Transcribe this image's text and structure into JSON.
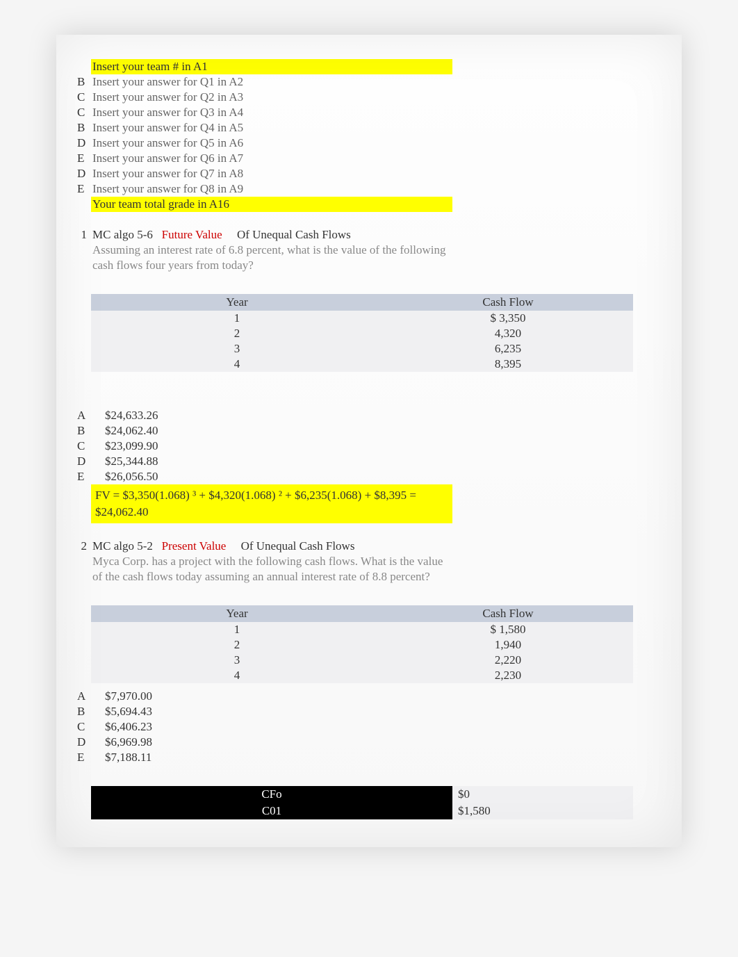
{
  "header": {
    "team_instruction": "Insert your team # in A1",
    "rows": [
      {
        "letter": "B",
        "text": "Insert your answer for Q1 in A2"
      },
      {
        "letter": "C",
        "text": "Insert your answer for Q2 in A3"
      },
      {
        "letter": "C",
        "text": "Insert your answer for Q3 in A4"
      },
      {
        "letter": "B",
        "text": "Insert your answer for Q4 in A5"
      },
      {
        "letter": "D",
        "text": "Insert your answer for Q5 in A6"
      },
      {
        "letter": "E",
        "text": "Insert your answer for Q6 in A7"
      },
      {
        "letter": "D",
        "text": "Insert your answer for Q7 in A8"
      },
      {
        "letter": "E",
        "text": "Insert your answer for Q8 in A9"
      }
    ],
    "grade_line": "Your team total grade in A16"
  },
  "q1": {
    "num": "1",
    "algo": "MC algo 5-6",
    "concept": "Future Value",
    "suffix": "Of Unequal Cash Flows",
    "desc": "Assuming an interest rate of 6.8 percent, what is the value of the following cash flows four years from today?",
    "table": {
      "h_year": "Year",
      "h_cf": "Cash Flow",
      "rows": [
        {
          "year": "1",
          "cf": "$  3,350"
        },
        {
          "year": "2",
          "cf": "4,320"
        },
        {
          "year": "3",
          "cf": "6,235"
        },
        {
          "year": "4",
          "cf": "8,395"
        }
      ]
    },
    "answers": [
      {
        "letter": "A",
        "val": "$24,633.26"
      },
      {
        "letter": "B",
        "val": "$24,062.40"
      },
      {
        "letter": "C",
        "val": "$23,099.90"
      },
      {
        "letter": "D",
        "val": "$25,344.88"
      },
      {
        "letter": "E",
        "val": "$26,056.50"
      }
    ],
    "formula_line1": "FV = $3,350(1.068)   ³ + $4,320(1.068)   ² + $6,235(1.068) + $8,395 =",
    "formula_line2": "$24,062.40"
  },
  "q2": {
    "num": "2",
    "algo": "MC algo 5-2",
    "concept": "Present Value",
    "suffix": "Of Unequal Cash Flows",
    "desc": "Myca Corp. has a project with the following cash flows. What is the value of the cash flows today assuming an annual interest rate of 8.8 percent?",
    "table": {
      "h_year": "Year",
      "h_cf": "Cash Flow",
      "rows": [
        {
          "year": "1",
          "cf": "$  1,580"
        },
        {
          "year": "2",
          "cf": "1,940"
        },
        {
          "year": "3",
          "cf": "2,220"
        },
        {
          "year": "4",
          "cf": "2,230"
        }
      ]
    },
    "answers": [
      {
        "letter": "A",
        "val": "$7,970.00"
      },
      {
        "letter": "B",
        "val": "$5,694.43"
      },
      {
        "letter": "C",
        "val": "$6,406.23"
      },
      {
        "letter": "D",
        "val": "$6,969.98"
      },
      {
        "letter": "E",
        "val": "$7,188.11"
      }
    ],
    "calc": [
      {
        "label": "CFo",
        "val": "$0"
      },
      {
        "label": "C01",
        "val": "$1,580"
      }
    ]
  }
}
